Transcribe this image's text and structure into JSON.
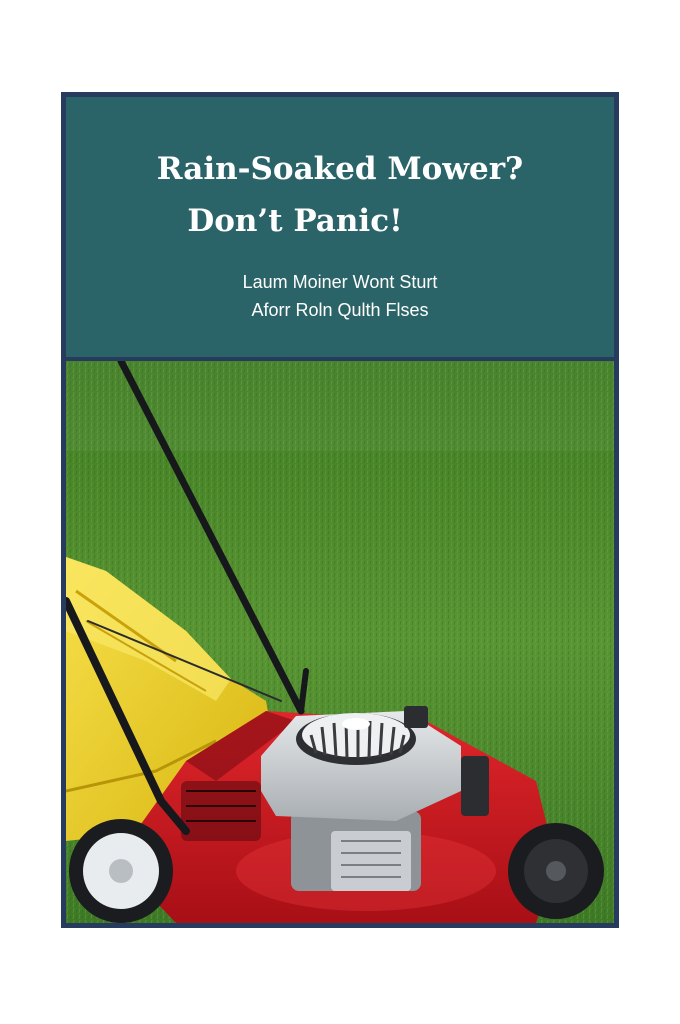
{
  "cover": {
    "title_lines": [
      "Rain-Soaked Mower?",
      "Don’t Panic!"
    ],
    "subtitle_lines": [
      "Laum Moiner Wont Sturt",
      "Aforr Roln Qulth Flses"
    ]
  },
  "photo": {
    "subject": "red-yellow-lawn-mower-on-grass",
    "colors": {
      "grass": "#4d8a2c",
      "mower_deck": "#d3161f",
      "bag": "#f2d41b",
      "engine": "#cfd3d6",
      "frame": "#263b5e",
      "header": "#2b6468"
    }
  }
}
